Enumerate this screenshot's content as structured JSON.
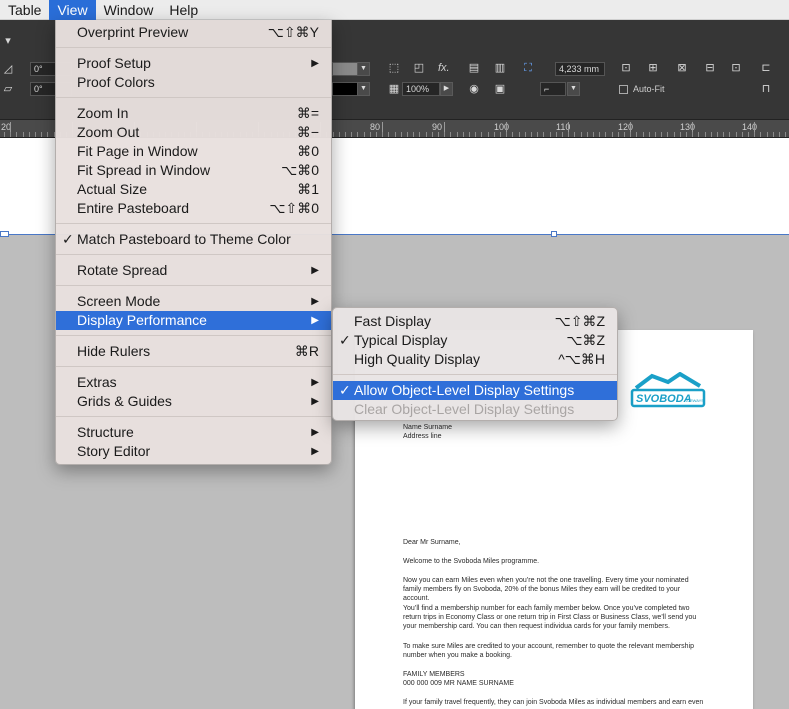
{
  "menubar": {
    "items": [
      {
        "label": "Table",
        "active": false
      },
      {
        "label": "View",
        "active": true
      },
      {
        "label": "Window",
        "active": false
      },
      {
        "label": "Help",
        "active": false
      }
    ]
  },
  "control_panel": {
    "angle1": "0°",
    "angle2": "0°",
    "fx": "fx.",
    "dimension": "4,233 mm",
    "zoom": "100%",
    "auto_fit": "Auto-Fit"
  },
  "ruler": {
    "labels": [
      "20",
      "80",
      "90",
      "100",
      "110",
      "120",
      "130",
      "140"
    ]
  },
  "view_menu": {
    "items": {
      "overprint_preview": {
        "label": "Overprint Preview",
        "shortcut": "⌥⇧⌘Y"
      },
      "proof_setup": {
        "label": "Proof Setup"
      },
      "proof_colors": {
        "label": "Proof Colors"
      },
      "zoom_in": {
        "label": "Zoom In",
        "shortcut": "⌘="
      },
      "zoom_out": {
        "label": "Zoom Out",
        "shortcut": "⌘−"
      },
      "fit_page": {
        "label": "Fit Page in Window",
        "shortcut": "⌘0"
      },
      "fit_spread": {
        "label": "Fit Spread in Window",
        "shortcut": "⌥⌘0"
      },
      "actual_size": {
        "label": "Actual Size",
        "shortcut": "⌘1"
      },
      "entire_pasteboard": {
        "label": "Entire Pasteboard",
        "shortcut": "⌥⇧⌘0"
      },
      "match_pasteboard": {
        "label": "Match Pasteboard to Theme Color",
        "checked": true
      },
      "rotate_spread": {
        "label": "Rotate Spread"
      },
      "screen_mode": {
        "label": "Screen Mode"
      },
      "display_performance": {
        "label": "Display Performance",
        "highlighted": true
      },
      "hide_rulers": {
        "label": "Hide Rulers",
        "shortcut": "⌘R"
      },
      "extras": {
        "label": "Extras"
      },
      "grids_guides": {
        "label": "Grids & Guides"
      },
      "structure": {
        "label": "Structure"
      },
      "story_editor": {
        "label": "Story Editor"
      }
    }
  },
  "display_submenu": {
    "items": {
      "fast": {
        "label": "Fast Display",
        "shortcut": "⌥⇧⌘Z"
      },
      "typical": {
        "label": "Typical Display",
        "shortcut": "⌥⌘Z",
        "checked": true
      },
      "high_quality": {
        "label": "High Quality Display",
        "shortcut": "^⌥⌘H"
      },
      "allow_object": {
        "label": "Allow Object-Level Display Settings",
        "checked": true,
        "highlighted": true
      },
      "clear_object": {
        "label": "Clear Object-Level Display Settings",
        "disabled": true
      }
    }
  },
  "symbols": {
    "check": "✓",
    "submenu_arrow": "▶"
  },
  "document": {
    "logo_text": "SVOBODA",
    "logo_small": "AIRWAYS",
    "name": "Name Surname",
    "address": "Address line",
    "salutation": "Dear Mr Surname,",
    "p1": "Welcome to the Svoboda Miles programme.",
    "p2": "Now you can earn Miles even when you’re not the one travelling. Every time your nominated family members fly on Svoboda, 20% of the bonus Miles they earn will be credited to your account.",
    "p3": "You’ll find a membership number for each family member below. Once you’ve completed two return trips in Economy Class or one return trip in First Class or Business Class, we’ll send you your membership card. You can then request individua cards for your family members.",
    "p4": "To make sure Miles are credited to your account, remember to quote the relevant membership number when you make a booking.",
    "family_heading": "FAMILY MEMBERS",
    "family_row": "000 000 009 MR NAME SURNAME",
    "p5": "If your family travel frequently, they can join Svoboda Miles as individual members and earn even"
  },
  "colors": {
    "highlight": "#2f6fd9",
    "logo": "#1aa0c8",
    "selection": "#4a78c7"
  }
}
